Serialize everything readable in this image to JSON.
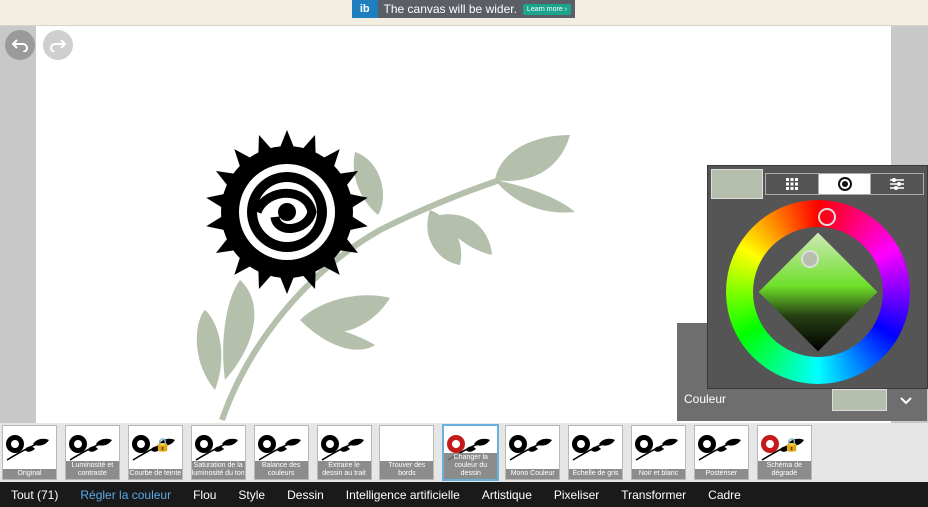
{
  "ad": {
    "text": "The canvas will be wider.",
    "button": "Learn more ›"
  },
  "toolbar": {
    "undo_icon": "undo-icon",
    "redo_icon": "redo-icon"
  },
  "color_picker": {
    "current_color": "#b6bfae",
    "tabs": [
      "grid-icon",
      "wheel-icon",
      "sliders-icon"
    ],
    "active_tab": 1
  },
  "color_panel": {
    "label": "Couleur",
    "color": "#b6bfae"
  },
  "filters": [
    {
      "label": "Original",
      "locked": false,
      "tinted": false
    },
    {
      "label": "Luminosité et contraste",
      "locked": false,
      "tinted": false
    },
    {
      "label": "Courbe de teinte",
      "locked": true,
      "tinted": false
    },
    {
      "label": "Saturation de la luminosité du ton",
      "locked": false,
      "tinted": false
    },
    {
      "label": "Balance des couleurs",
      "locked": false,
      "tinted": false
    },
    {
      "label": "Extraire le dessin au trait",
      "locked": false,
      "tinted": false
    },
    {
      "label": "Trouver des bords",
      "locked": false,
      "tinted": false
    },
    {
      "label": "Changer la couleur du dessin",
      "locked": false,
      "tinted": true,
      "active": true
    },
    {
      "label": "Mono Couleur",
      "locked": false,
      "tinted": false
    },
    {
      "label": "Échelle de gris",
      "locked": false,
      "tinted": false
    },
    {
      "label": "Noir et blanc",
      "locked": false,
      "tinted": false
    },
    {
      "label": "Postériser",
      "locked": false,
      "tinted": false
    },
    {
      "label": "Schéma de dégradé",
      "locked": true,
      "tinted": true
    }
  ],
  "nav": [
    {
      "label": "Tout (71)",
      "active": false
    },
    {
      "label": "Régler la couleur",
      "active": true
    },
    {
      "label": "Flou",
      "active": false
    },
    {
      "label": "Style",
      "active": false
    },
    {
      "label": "Dessin",
      "active": false
    },
    {
      "label": "Intelligence artificielle",
      "active": false
    },
    {
      "label": "Artistique",
      "active": false
    },
    {
      "label": "Pixeliser",
      "active": false
    },
    {
      "label": "Transformer",
      "active": false
    },
    {
      "label": "Cadre",
      "active": false
    }
  ]
}
